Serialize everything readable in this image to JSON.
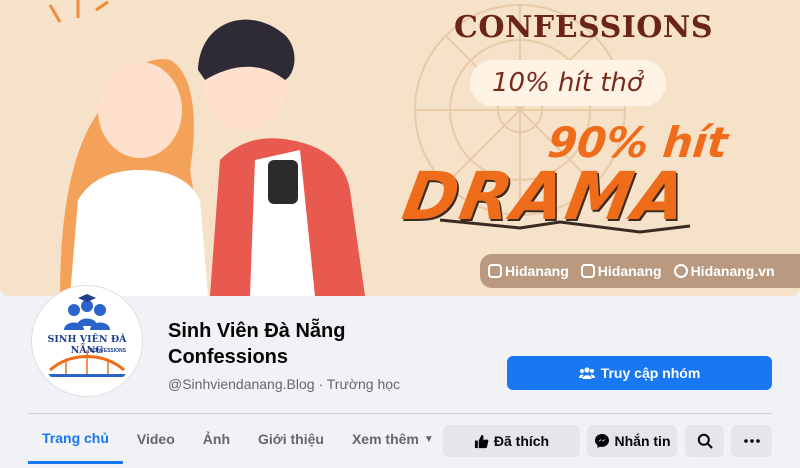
{
  "cover": {
    "headline_1": "CONFESSIONS",
    "headline_2": "10% hít thở",
    "headline_3": "90% hít",
    "headline_4": "DRAMA",
    "socials": [
      {
        "icon": "youtube-icon",
        "label": "Hidanang"
      },
      {
        "icon": "tiktok-icon",
        "label": "Hidanang"
      },
      {
        "icon": "instagram-icon",
        "label": "Hidanang.vn"
      }
    ]
  },
  "avatar": {
    "title": "SINH VIÊN ĐÀ NẴNG",
    "subtitle": "CONFESSIONS"
  },
  "page": {
    "name_line1": "Sinh Viên Đà Nẵng",
    "name_line2": "Confessions",
    "handle": "@Sinhviendanang.Blog",
    "separator": "·",
    "category": "Trường học"
  },
  "join_button": "Truy cập nhóm",
  "tabs": [
    {
      "label": "Trang chủ",
      "active": true
    },
    {
      "label": "Video"
    },
    {
      "label": "Ảnh"
    },
    {
      "label": "Giới thiệu"
    },
    {
      "label": "Xem thêm"
    }
  ],
  "actions": {
    "like": "Đã thích",
    "message": "Nhắn tin"
  },
  "colors": {
    "accent": "#1877f2",
    "cover_bg": "#f6e2c9",
    "drama_orange": "#ef6c1b"
  }
}
